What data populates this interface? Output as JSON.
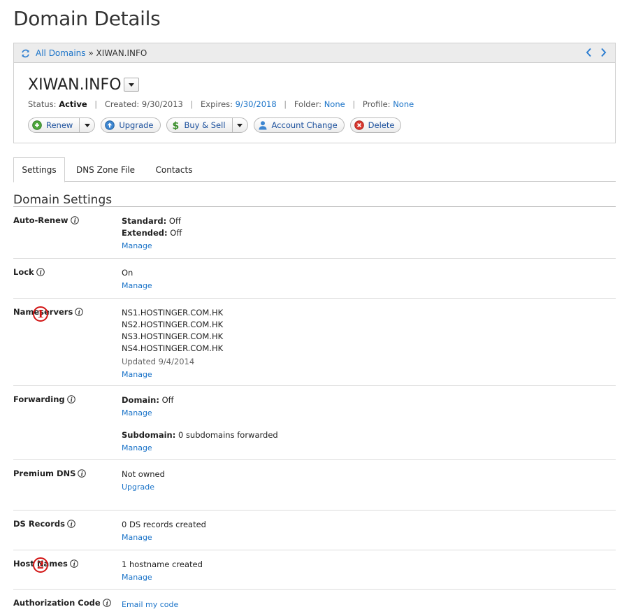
{
  "page": {
    "title": "Domain Details"
  },
  "breadcrumb": {
    "root": "All Domains",
    "separator": "»",
    "current": "XIWAN.INFO"
  },
  "domain": {
    "name": "XIWAN.INFO",
    "status_label": "Status:",
    "status_value": "Active",
    "created_label": "Created:",
    "created_value": "9/30/2013",
    "expires_label": "Expires:",
    "expires_value": "9/30/2018",
    "folder_label": "Folder:",
    "folder_value": "None",
    "profile_label": "Profile:",
    "profile_value": "None"
  },
  "actions": {
    "renew": "Renew",
    "upgrade": "Upgrade",
    "buy_sell": "Buy & Sell",
    "account_change": "Account Change",
    "delete": "Delete"
  },
  "tabs": [
    {
      "label": "Settings",
      "active": true
    },
    {
      "label": "DNS Zone File",
      "active": false
    },
    {
      "label": "Contacts",
      "active": false
    }
  ],
  "section": {
    "title": "Domain Settings"
  },
  "settings": {
    "auto_renew": {
      "label": "Auto-Renew",
      "standard_label": "Standard:",
      "standard_value": "Off",
      "extended_label": "Extended:",
      "extended_value": "Off",
      "link": "Manage"
    },
    "lock": {
      "label": "Lock",
      "value": "On",
      "link": "Manage"
    },
    "nameservers": {
      "label": "Nameservers",
      "servers": [
        "NS1.HOSTINGER.COM.HK",
        "NS2.HOSTINGER.COM.HK",
        "NS3.HOSTINGER.COM.HK",
        "NS4.HOSTINGER.COM.HK"
      ],
      "updated": "Updated 9/4/2014",
      "link": "Manage"
    },
    "forwarding": {
      "label": "Forwarding",
      "domain_label": "Domain:",
      "domain_value": "Off",
      "domain_link": "Manage",
      "subdomain_label": "Subdomain:",
      "subdomain_value": "0 subdomains forwarded",
      "subdomain_link": "Manage"
    },
    "premium_dns": {
      "label": "Premium DNS",
      "value": "Not owned",
      "link": "Upgrade"
    },
    "ds_records": {
      "label": "DS Records",
      "value": "0 DS records created",
      "link": "Manage"
    },
    "host_names": {
      "label": "Host Names",
      "value": "1 hostname created",
      "link": "Manage"
    },
    "auth_code": {
      "label": "Authorization Code",
      "link": "Email my code"
    }
  },
  "annotations": {
    "marker_1": "1",
    "marker_2": "2"
  },
  "colors": {
    "link": "#1a73c8",
    "marker": "#d21414",
    "header_bg": "#ececec"
  }
}
